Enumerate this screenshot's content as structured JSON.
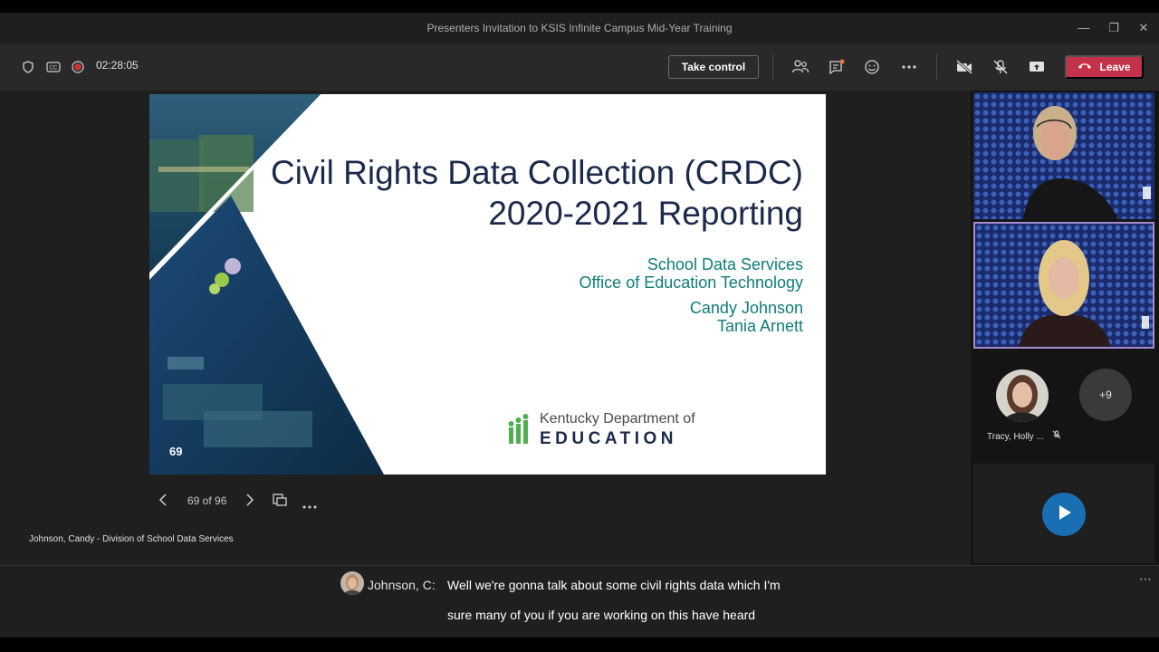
{
  "window": {
    "title": "Presenters Invitation to KSIS Infinite Campus Mid-Year Training"
  },
  "toolbar": {
    "timer": "02:28:05",
    "take_control_label": "Take control",
    "leave_label": "Leave",
    "accent_leave": "#c4314b"
  },
  "slide": {
    "title_line1": "Civil Rights Data Collection (CRDC)",
    "title_line2": "2020-2021 Reporting",
    "org_line1": "School Data Services",
    "org_line2": "Office of Education Technology",
    "presenter1": "Candy Johnson",
    "presenter2": "Tania Arnett",
    "logo_line1": "Kentucky Department of",
    "logo_line2": "EDUCATION",
    "slide_number": "69"
  },
  "slide_nav": {
    "counter": "69 of 96"
  },
  "presenter": {
    "name": "Johnson, Candy - Division of School Data Services"
  },
  "participants": {
    "avatar_name": "Tracy, Holly ...",
    "more_count": "+9"
  },
  "captions": {
    "speaker": "Johnson, C:",
    "line1": "Well we're gonna talk about some civil rights data which I'm",
    "line2": "sure many of you if you are working on this have heard"
  }
}
